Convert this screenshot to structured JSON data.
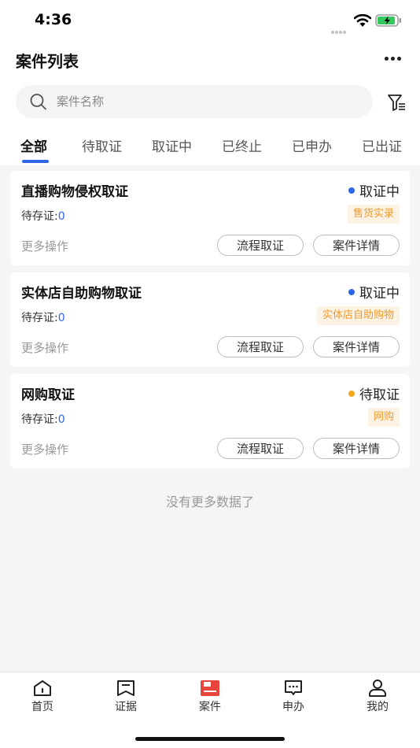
{
  "status_bar": {
    "time": "4:36"
  },
  "nav": {
    "title": "案件列表"
  },
  "search": {
    "placeholder": "案件名称"
  },
  "tabs": [
    {
      "label": "全部",
      "active": true
    },
    {
      "label": "待取证",
      "active": false
    },
    {
      "label": "取证中",
      "active": false
    },
    {
      "label": "已终止",
      "active": false
    },
    {
      "label": "已申办",
      "active": false
    },
    {
      "label": "已出证",
      "active": false
    }
  ],
  "cases": [
    {
      "title": "直播购物侵权取证",
      "status": "取证中",
      "status_color": "#2e66e8",
      "pending_label": "待存证:",
      "pending_count": "0",
      "tag": "售货实录",
      "more_label": "更多操作",
      "flow_button": "流程取证",
      "detail_button": "案件详情"
    },
    {
      "title": "实体店自助购物取证",
      "status": "取证中",
      "status_color": "#2e66e8",
      "pending_label": "待存证:",
      "pending_count": "0",
      "tag": "实体店自助购物",
      "more_label": "更多操作",
      "flow_button": "流程取证",
      "detail_button": "案件详情"
    },
    {
      "title": "网购取证",
      "status": "待取证",
      "status_color": "#f5a623",
      "pending_label": "待存证:",
      "pending_count": "0",
      "tag": "网购",
      "more_label": "更多操作",
      "flow_button": "流程取证",
      "detail_button": "案件详情"
    }
  ],
  "footer_text": "没有更多数据了",
  "tabbar": [
    {
      "label": "首页",
      "icon": "home-icon",
      "active": false
    },
    {
      "label": "证据",
      "icon": "evidence-icon",
      "active": false
    },
    {
      "label": "案件",
      "icon": "case-folder-icon",
      "active": true
    },
    {
      "label": "申办",
      "icon": "apply-chat-icon",
      "active": false
    },
    {
      "label": "我的",
      "icon": "profile-icon",
      "active": false
    }
  ],
  "colors": {
    "accent": "#2e66e8",
    "active_tab": "#e8453c",
    "tag_text": "#f09a2b",
    "tag_bg": "#fdf2e3",
    "pending_dot": "#f5a623"
  }
}
